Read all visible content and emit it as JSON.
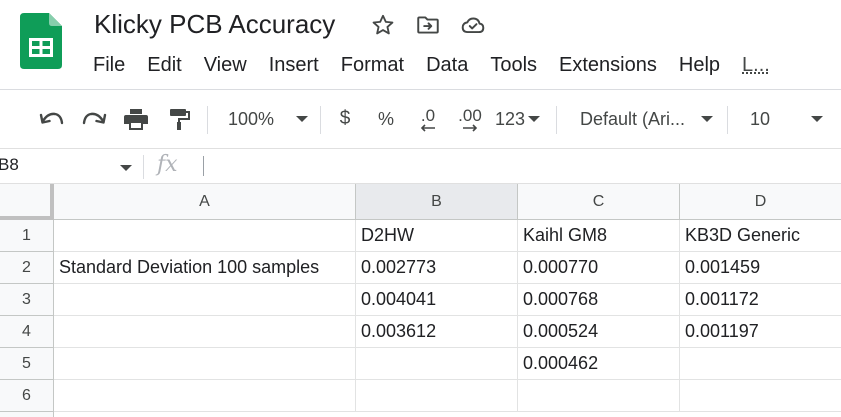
{
  "document": {
    "title": "Klicky PCB Accuracy",
    "icons": [
      "star-icon",
      "move-to-folder-icon",
      "cloud-status-icon"
    ]
  },
  "menu": [
    "File",
    "Edit",
    "View",
    "Insert",
    "Format",
    "Data",
    "Tools",
    "Extensions",
    "Help",
    "L..."
  ],
  "toolbar": {
    "zoom": "100%",
    "currency": "$",
    "percent": "%",
    "decrease_decimal": ".0",
    "increase_decimal": ".00",
    "more_formats": "123",
    "font": "Default (Ari...",
    "font_size": "10"
  },
  "formula_bar": {
    "name_box": "B8",
    "fx": "fx",
    "formula": ""
  },
  "sheet": {
    "columns": [
      "A",
      "B",
      "C",
      "D"
    ],
    "selected_column": "B",
    "rows": [
      "1",
      "2",
      "3",
      "4",
      "5",
      "6"
    ],
    "cells": [
      [
        "",
        "D2HW",
        "Kaihl GM8",
        "KB3D Generic"
      ],
      [
        "Standard Deviation 100 samples",
        "0.002773",
        "0.000770",
        "0.001459"
      ],
      [
        "",
        "0.004041",
        "0.000768",
        "0.001172"
      ],
      [
        "",
        "0.003612",
        "0.000524",
        "0.001197"
      ],
      [
        "",
        "",
        "0.000462",
        ""
      ],
      [
        "",
        "",
        "",
        ""
      ]
    ]
  },
  "colors": {
    "sheets_green": "#0f9d58",
    "header_bg": "#f8f9fa",
    "selected_header_bg": "#e8eaed"
  }
}
